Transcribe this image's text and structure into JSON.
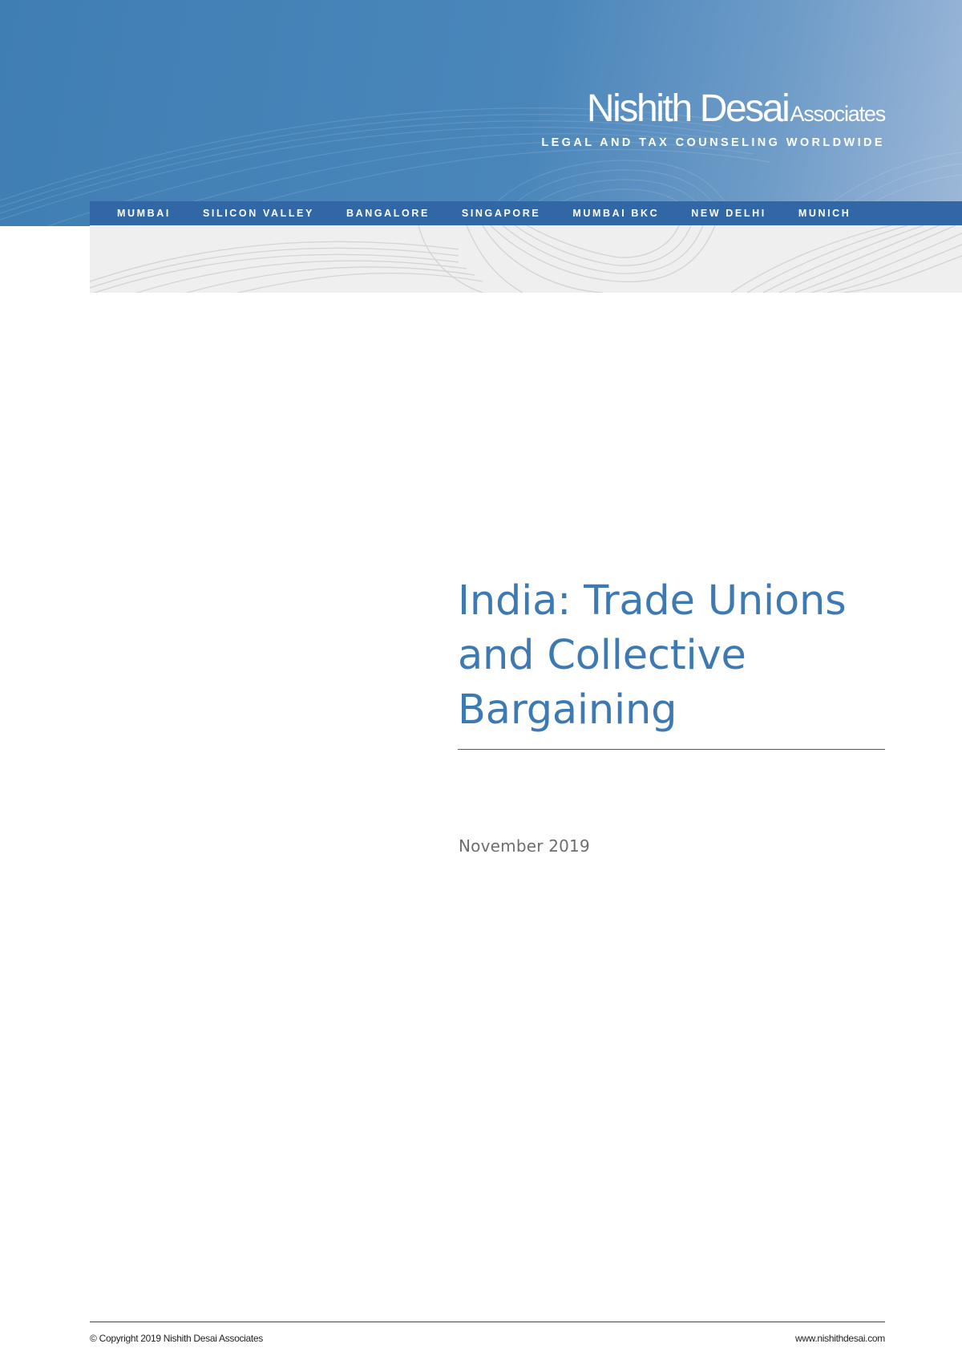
{
  "header": {
    "logo_main": "Nishith Desai",
    "logo_sub": "Associates",
    "tagline": "LEGAL AND TAX COUNSELING WORLDWIDE"
  },
  "offices": [
    "MUMBAI",
    "SILICON VALLEY",
    "BANGALORE",
    "SINGAPORE",
    "MUMBAI BKC",
    "NEW DELHI",
    "MUNICH"
  ],
  "document": {
    "title_lines": [
      "India: Trade Unions",
      "and Collective",
      "Bargaining"
    ],
    "date": "November 2019"
  },
  "footer": {
    "copyright": "© Copyright 2019 Nishith Desai Associates",
    "website": "www.nishithdesai.com"
  },
  "colors": {
    "banner_blue": "#4a86ba",
    "nav_blue": "#3167a5",
    "title_blue": "#3d7ab4",
    "date_grey": "#6b6e73"
  }
}
